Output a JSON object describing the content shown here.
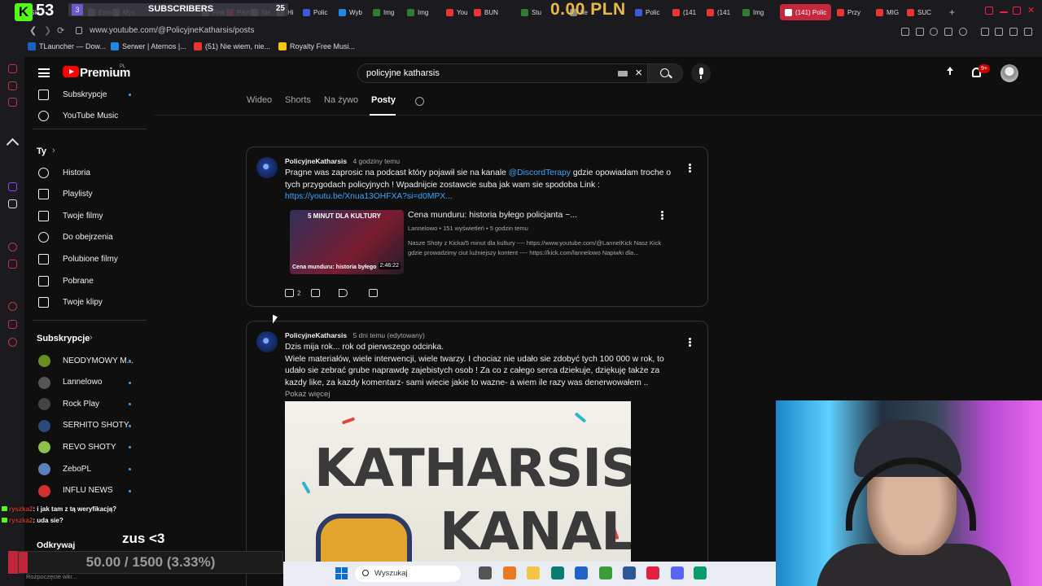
{
  "overlay": {
    "k_logo": "K",
    "viewer_count": "53",
    "subs_count": "3",
    "subs_label": "SUBSCRIBERS",
    "subs_goal": "25",
    "money": "0.00 PLN"
  },
  "tabs": [
    {
      "label": "Sie",
      "color": "#53fc18"
    },
    {
      "label": "Emo",
      "color": "#888888"
    },
    {
      "label": "Mys",
      "color": "#888888"
    },
    {
      "label": "Sie",
      "color": "#888888"
    },
    {
      "label": "Fink",
      "color": "#888888"
    },
    {
      "label": "Payt",
      "color": "#e33"
    },
    {
      "label": "Hi",
      "color": "#888888"
    },
    {
      "label": "Polic",
      "color": "#3b5bdb"
    },
    {
      "label": "Wyb",
      "color": "#1e88e5"
    },
    {
      "label": "Img",
      "color": "#2e7d32"
    },
    {
      "label": "Img",
      "color": "#2e7d32"
    },
    {
      "label": "You",
      "color": "#e33"
    },
    {
      "label": "BUN",
      "color": "#e33"
    },
    {
      "label": "Stu",
      "color": "#2e7d32"
    },
    {
      "label": "he",
      "color": "#888888"
    },
    {
      "label": "Polic",
      "color": "#3b5bdb"
    },
    {
      "label": "(141",
      "color": "#e33"
    },
    {
      "label": "(141",
      "color": "#e33"
    },
    {
      "label": "Img",
      "color": "#2e7d32"
    },
    {
      "label": "(141) Polic",
      "color": "#ffffff",
      "active": true
    },
    {
      "label": "Przy",
      "color": "#e33"
    },
    {
      "label": "MIG",
      "color": "#e33"
    },
    {
      "label": "SUC",
      "color": "#e33"
    }
  ],
  "address": {
    "url": "www.youtube.com/@PolicyjneKatharsis/posts"
  },
  "bookmarks": [
    {
      "label": "TLauncher — Dow...",
      "color": "#1565c0"
    },
    {
      "label": "Serwer | Aternos |...",
      "color": "#1e88e5"
    },
    {
      "label": "(51) Nie wiem, nie...",
      "color": "#e33"
    },
    {
      "label": "Royalty Free Musi...",
      "color": "#f5c518"
    }
  ],
  "yt": {
    "brand": "Premium",
    "region": "PL",
    "search_query": "policyjne katharsis",
    "notifications": "9+"
  },
  "nav": {
    "top_items": [
      {
        "label": "Subskrypcje",
        "icon": "subscriptions-icon"
      },
      {
        "label": "YouTube Music",
        "icon": "music-icon"
      }
    ],
    "you_section": "Ty",
    "you_items": [
      {
        "label": "Historia",
        "icon": "history-icon"
      },
      {
        "label": "Playlisty",
        "icon": "playlists-icon"
      },
      {
        "label": "Twoje filmy",
        "icon": "your-videos-icon"
      },
      {
        "label": "Do obejrzenia",
        "icon": "watch-later-icon"
      },
      {
        "label": "Polubione filmy",
        "icon": "liked-icon"
      },
      {
        "label": "Pobrane",
        "icon": "download-icon"
      },
      {
        "label": "Twoje klipy",
        "icon": "clips-icon"
      }
    ],
    "subs_section": "Subskrypcje",
    "channels": [
      {
        "label": "NEODYMOWY M...",
        "color": "#6b8e23"
      },
      {
        "label": "Lannelowo",
        "color": "#555555"
      },
      {
        "label": "Rock Play",
        "color": "#444444"
      },
      {
        "label": "SERHITO SHOTY",
        "color": "#2b4a7a"
      },
      {
        "label": "REVO SHOTY",
        "color": "#8bc34a"
      },
      {
        "label": "ZeboPL",
        "color": "#5b7fbf"
      },
      {
        "label": "INFLU NEWS",
        "color": "#d32f2f"
      }
    ],
    "explore": "Odkrywaj"
  },
  "filters": {
    "tabs": [
      "Wideo",
      "Shorts",
      "Na żywo",
      "Posty"
    ],
    "active": "Posty"
  },
  "post1": {
    "author": "PolicyjneKatharsis",
    "time": "4 godziny temu",
    "text_a": "Pragne was zaprosic na podcast który pojawił sie na kanale ",
    "mention": "@DiscordTerapy",
    "text_b": " gdzie opowiadam troche o tych przygodach policyjnych ! Wpadnijcie zostawcie suba jak wam sie spodoba Link :",
    "link": "https://youtu.be/Xnua13OHFXA?si=d0MPX...",
    "video": {
      "thumb_top": "5 MINUT DLA KULTURY",
      "thumb_caption": "Cena munduru: historia byłego",
      "duration": "2:46:22",
      "title": "Cena munduru: historia byłego policjanta ~...",
      "meta": "Lannelowo • 151 wyświetleń • 5 godzin temu",
      "desc": "Nasze Shoty z Kicka/5 minut dla kultury ---- https://www.youtube.com/@LannelKick Nasz Kick gdzie prowadzimy ciut luźniejszy kontent ---- https://kick.com/lannelowo Napiwki dla..."
    },
    "likes": "2"
  },
  "post2": {
    "author": "PolicyjneKatharsis",
    "time": "5 dni temu (edytowany)",
    "text": "Dzis mija rok... rok od pierwszego odcinka.\nWiele materiałów, wiele interwencji, wiele twarzy. I chociaz nie udało sie zdobyć tych 100 000 w rok, to udało sie zebrać grube naprawdę zajebistych osob ! Za co z całego serca dziekuje, dziękuję także za kazdy like, za kazdy komentarz- sami wiecie jakie to wazne- a wiem ile razy was denerwowałem ..",
    "show_more": "Pokaż więcej",
    "image_word1": "KATHARSIS",
    "image_word2": "KANAL"
  },
  "chat": [
    {
      "user": "ryszka2",
      "text": ": i jak tam z tą weryfikacją?"
    },
    {
      "user": "ryszka2",
      "text": ": uda sie?"
    }
  ],
  "stream": {
    "zus": "zus <3",
    "goal_text": "50.00 / 1500 (3.33%)",
    "goal_fraction": 0.0333,
    "note": "Rozpoczęcie wkr..."
  },
  "taskbar": {
    "search": "Wyszukaj",
    "apps": [
      {
        "color": "#555555"
      },
      {
        "color": "#e87722"
      },
      {
        "color": "#f4c542"
      },
      {
        "color": "#0a7c6e"
      },
      {
        "color": "#1e63c7"
      },
      {
        "color": "#3a9f3a"
      },
      {
        "color": "#2b5797"
      },
      {
        "color": "#e02040"
      },
      {
        "color": "#5865f2"
      },
      {
        "color": "#0a9c6b"
      }
    ]
  }
}
